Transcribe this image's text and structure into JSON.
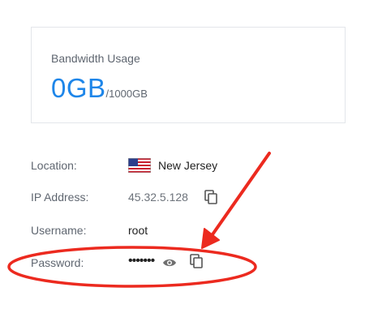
{
  "bandwidth": {
    "title": "Bandwidth Usage",
    "value": "0GB",
    "total": "/1000GB"
  },
  "details": {
    "location": {
      "label": "Location:",
      "value": "New Jersey",
      "flag_icon": "us-flag-icon"
    },
    "ip": {
      "label": "IP Address:",
      "value": "45.32.5.128",
      "action_icon": "copy-icon"
    },
    "username": {
      "label": "Username:",
      "value": "root"
    },
    "password": {
      "label": "Password:",
      "masked": "•••••••",
      "show_icon": "eye-icon",
      "copy_icon": "copy-icon"
    }
  },
  "colors": {
    "accent": "#1e86e9",
    "annotation": "#ec2a1f"
  }
}
